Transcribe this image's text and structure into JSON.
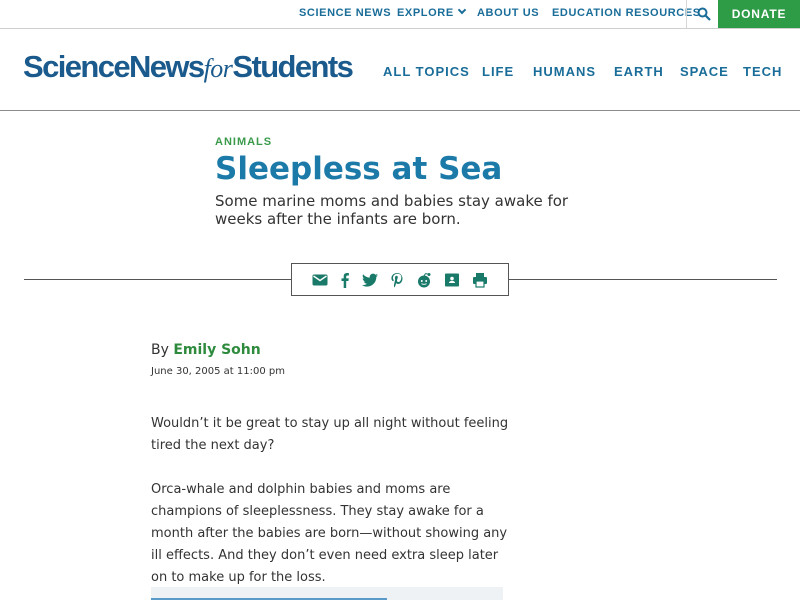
{
  "topbar": {
    "links": [
      {
        "label": "SCIENCE NEWS"
      },
      {
        "label": "EXPLORE"
      },
      {
        "label": "ABOUT US"
      },
      {
        "label": "EDUCATION RESOURCES"
      }
    ],
    "search_icon": "search-icon",
    "donate_label": "DONATE"
  },
  "header": {
    "logo": {
      "part1": "ScienceNews",
      "part2": "for",
      "part3": "Students"
    },
    "nav": [
      "ALL TOPICS",
      "LIFE",
      "HUMANS",
      "EARTH",
      "SPACE",
      "TECH"
    ]
  },
  "article": {
    "kicker": "ANIMALS",
    "title": "Sleepless at Sea",
    "dek": "Some marine moms and babies stay awake for weeks after the infants are born.",
    "share_icons": [
      "email-icon",
      "facebook-icon",
      "twitter-icon",
      "pinterest-icon",
      "reddit-icon",
      "google-classroom-icon",
      "print-icon"
    ],
    "byline_prefix": "By",
    "author": "Emily Sohn",
    "date": "June 30, 2005 at 11:00 pm",
    "paragraphs": [
      "Wouldn’t it be great to stay up all night without feeling tired the next day?",
      "Orca-whale and dolphin babies and moms are champions of sleeplessness. They stay awake for a month after the babies are born—without showing any ill effects. And they don’t even need extra sleep later on to make up for the loss."
    ]
  },
  "colors": {
    "brand_blue": "#1a6d99",
    "title_blue": "#1b7aa8",
    "accent_green": "#2e9b47"
  }
}
